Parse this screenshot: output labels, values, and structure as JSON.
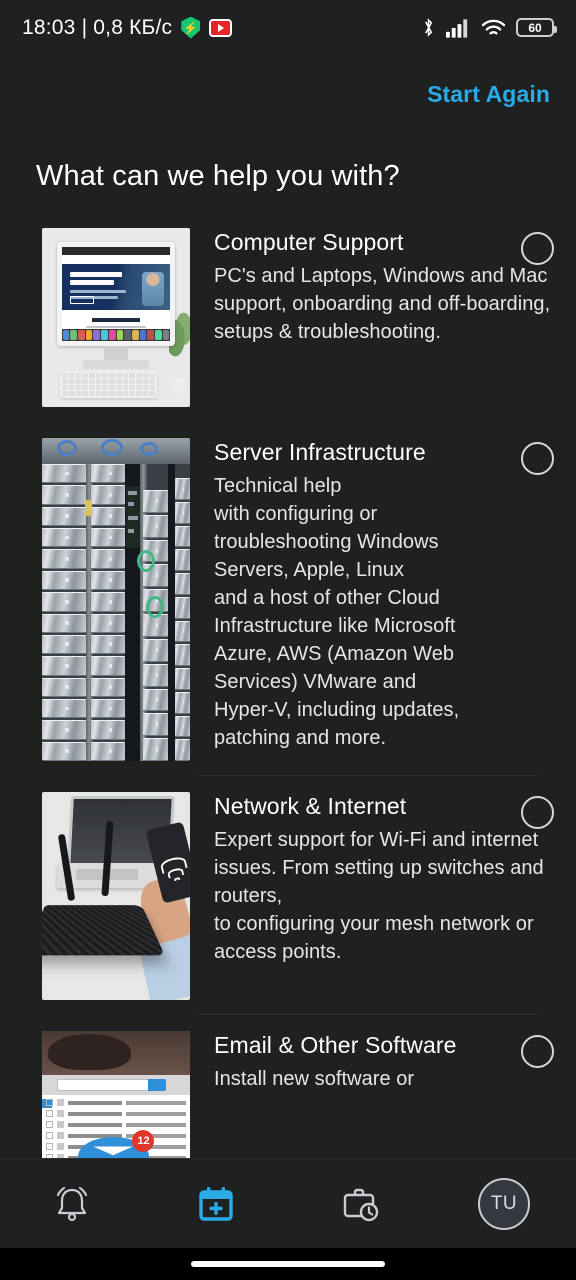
{
  "status_bar": {
    "clock": "18:03 | 0,8 КБ/с",
    "shield_icon": "shield-icon",
    "youtube_icon": "youtube-icon",
    "bluetooth_icon": "bluetooth-icon",
    "signal_icon": "cellular-signal-icon",
    "wifi_icon": "wifi-icon",
    "battery_level": "60"
  },
  "top_bar": {
    "start_again_label": "Start Again",
    "accent_color": "#29abe8"
  },
  "heading": "What can we help you with?",
  "options": [
    {
      "title": "Computer Support",
      "description": "PC's and Laptops, Windows and Mac support, onboarding and off-boarding, setups & troubleshooting.",
      "thumbnail": "imac-desktop-photo",
      "selected": false
    },
    {
      "title": "Server Infrastructure",
      "description": "Technical help\nwith configuring or\ntroubleshooting Windows\nServers, Apple, Linux\nand a host of other Cloud\nInfrastructure like Microsoft\nAzure, AWS (Amazon Web\nServices) VMware and\nHyper-V, including updates,\npatching and more.",
      "thumbnail": "server-racks-photo",
      "selected": false
    },
    {
      "title": "Network & Internet",
      "description": "Expert support for Wi-Fi and internet issues. From setting up switches and routers,\nto configuring your mesh network or access points.",
      "thumbnail": "router-laptop-photo",
      "selected": false
    },
    {
      "title": "Email & Other Software",
      "description": "Install new software or",
      "thumbnail": "email-inbox-photo",
      "selected": false
    }
  ],
  "bottom_nav": [
    {
      "name": "notifications",
      "icon": "bell-icon",
      "active": false
    },
    {
      "name": "new-booking",
      "icon": "calendar-plus-icon",
      "active": true
    },
    {
      "name": "history",
      "icon": "briefcase-clock-icon",
      "active": false
    },
    {
      "name": "profile",
      "icon": "avatar",
      "initials": "TU",
      "active": false
    }
  ],
  "colors": {
    "background": "#1f2020",
    "accent": "#29abe8",
    "text_primary": "#ffffff",
    "text_secondary": "#e6e6e6",
    "radio_ring": "#d8d8d8"
  }
}
